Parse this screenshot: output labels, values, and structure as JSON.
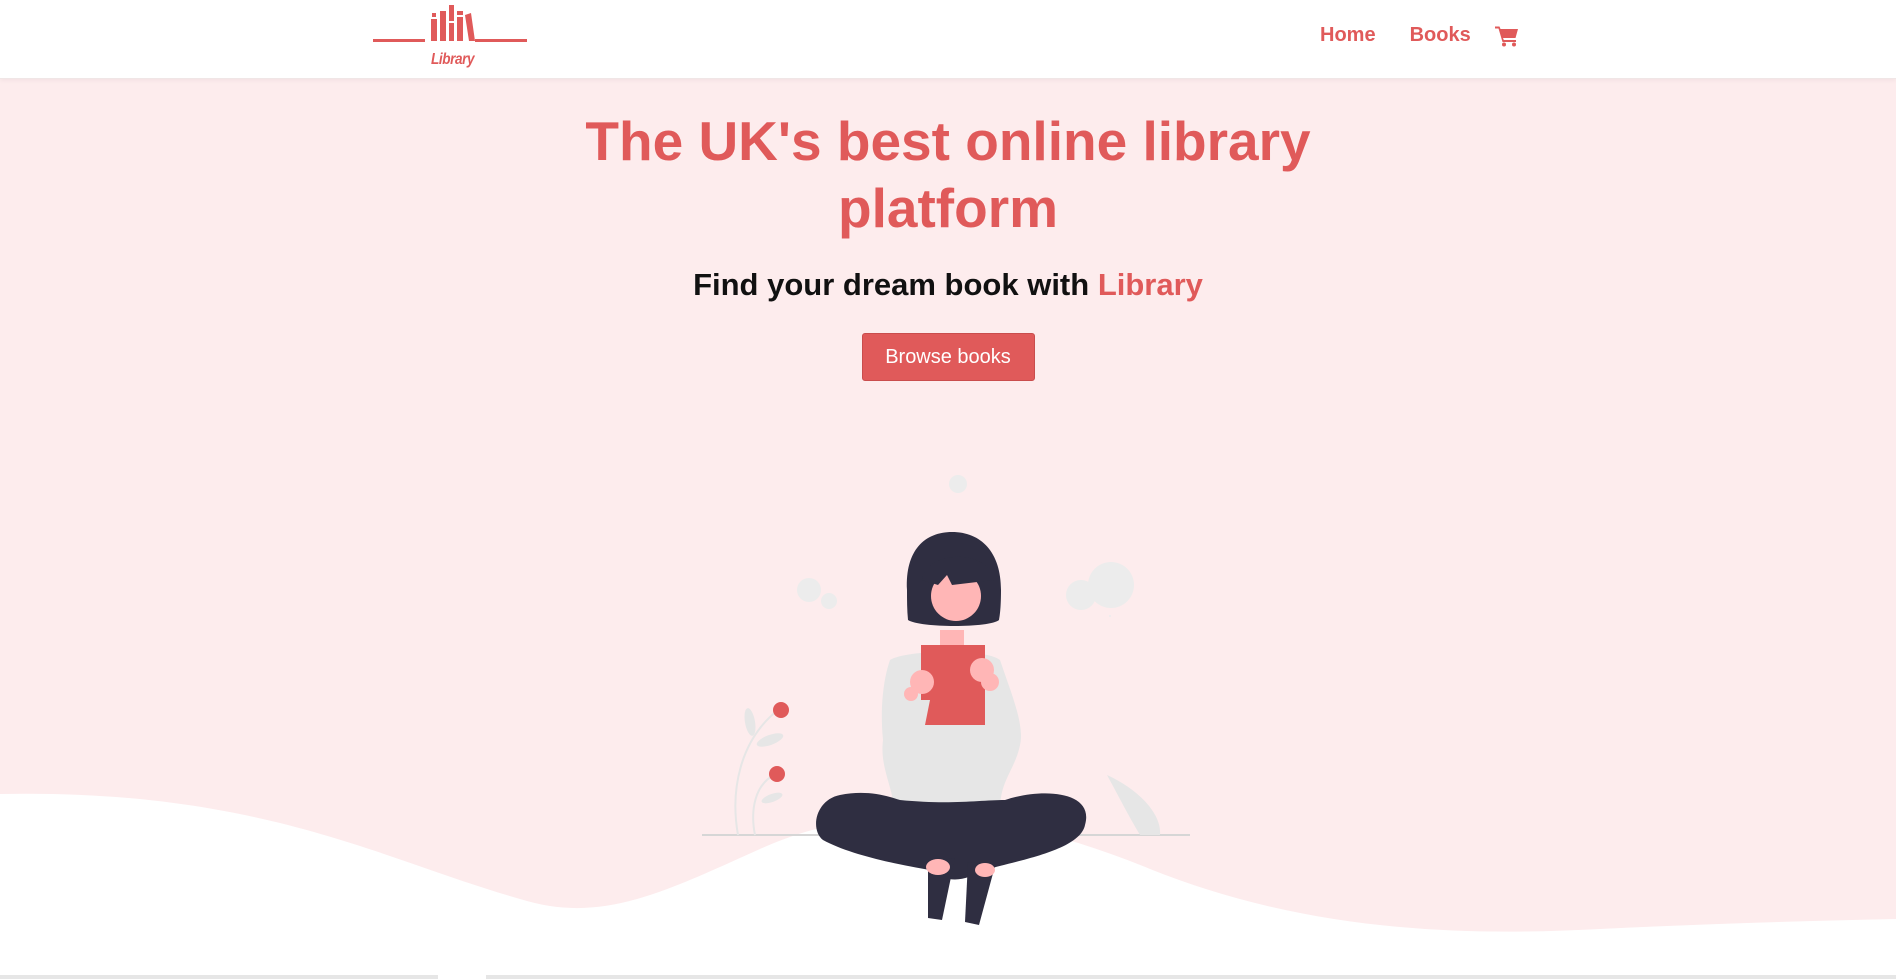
{
  "nav": {
    "logo_text": "Library",
    "links": [
      {
        "label": "Home"
      },
      {
        "label": "Books"
      }
    ],
    "cart_icon": "shopping-cart-icon"
  },
  "hero": {
    "title": "The UK's best online library platform",
    "subtitle_prefix": "Find your dream book with ",
    "subtitle_accent": "Library",
    "button_label": "Browse books"
  },
  "colors": {
    "accent": "#e05a5a",
    "hero_background": "#fdeced",
    "text_dark": "#111111",
    "illustration_dark": "#2f2e41",
    "illustration_light": "#e6e6e6",
    "skin": "#ffb6b6"
  }
}
